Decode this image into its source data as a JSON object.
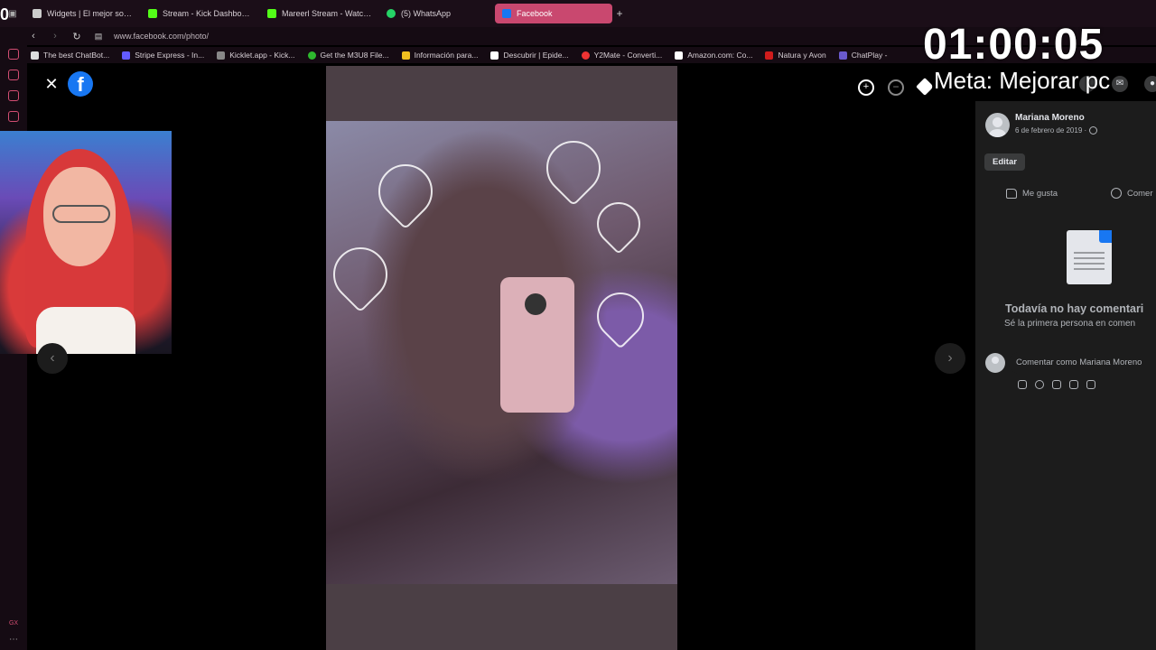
{
  "browser": {
    "tabs": [
      {
        "label": "Widgets | El mejor softwa",
        "color": "#cccccc"
      },
      {
        "label": "Stream - Kick Dashboard",
        "color": "#53fc18"
      },
      {
        "label": "Mareerl Stream - Watch L",
        "color": "#53fc18"
      },
      {
        "label": "(5) WhatsApp",
        "color": "#25d366"
      },
      {
        "label": "Facebook",
        "color": "#1877f2"
      }
    ],
    "url": "www.facebook.com/photo/",
    "bookmarks": [
      {
        "label": "The best ChatBot...",
        "color": "#dddddd"
      },
      {
        "label": "Stripe Express - In...",
        "color": "#635bff"
      },
      {
        "label": "Kicklet.app - Kick...",
        "color": "#888888"
      },
      {
        "label": "Get the M3U8 File...",
        "color": "#2eb82e"
      },
      {
        "label": "Información para...",
        "color": "#f0c020"
      },
      {
        "label": "Descubrir | Epide...",
        "color": "#ffffff"
      },
      {
        "label": "Y2Mate - Converti...",
        "color": "#e33"
      },
      {
        "label": "Amazon.com: Co...",
        "color": "#ffffff"
      },
      {
        "label": "Natura y Avon",
        "color": "#d01c1c"
      },
      {
        "label": "ChatPlay -",
        "color": "#6a5acd"
      }
    ],
    "side_bottom": "GX"
  },
  "overlay": {
    "timer": "01:00:05",
    "goal": "Meta: Mejorar pc",
    "edge_glyph": "0"
  },
  "viewer": {
    "close": "✕",
    "logo": "f",
    "prev": "‹",
    "next": "›"
  },
  "panel": {
    "author": "Mariana Moreno",
    "date": "6 de febrero de 2019 ·",
    "edit": "Editar",
    "like": "Me gusta",
    "comment": "Comer",
    "empty_title": "Todavía no hay comentari",
    "empty_sub": "Sé la primera persona en comen",
    "comment_placeholder": "Comentar como Mariana Moreno"
  }
}
